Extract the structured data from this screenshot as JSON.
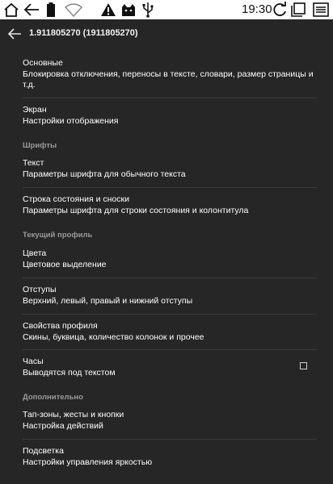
{
  "statusbar": {
    "time": "19:30",
    "icons": [
      "home-icon",
      "back-arrow-icon",
      "battery-icon",
      "wifi-icon",
      "warning-icon",
      "cat-app-icon",
      "usb-icon",
      "refresh-icon",
      "recent-apps-icon",
      "menu-icon"
    ]
  },
  "toolbar": {
    "title": "1.911805270 (1911805270)"
  },
  "items": [
    {
      "title": "Основные",
      "subtitle": "Блокировка отключения, переносы в тексте, словари, размер страницы и т.д."
    },
    {
      "title": "Экран",
      "subtitle": "Настройки отображения"
    },
    {
      "title": "Текст",
      "subtitle": "Параметры шрифта для обычного текста"
    },
    {
      "title": "Строка состояния и сноски",
      "subtitle": "Параметры шрифта для строки состояния и колонтитула"
    },
    {
      "title": "Цвета",
      "subtitle": "Цветовое выделение"
    },
    {
      "title": "Отступы",
      "subtitle": "Верхний, левый, правый и нижний отступы"
    },
    {
      "title": "Свойства профиля",
      "subtitle": "Скины, буквица, количество колонок и прочее"
    },
    {
      "title": "Часы",
      "subtitle": "Выводятся под текстом"
    },
    {
      "title": "Тап-зоны, жесты и кнопки",
      "subtitle": "Настройка действий"
    },
    {
      "title": "Подсветка",
      "subtitle": "Настройки управления яркостью"
    }
  ],
  "sections": {
    "fonts": "Шрифты",
    "profile": "Текущий профиль",
    "extra": "Дополнительно"
  },
  "clock_checkbox": {
    "checked": false
  }
}
